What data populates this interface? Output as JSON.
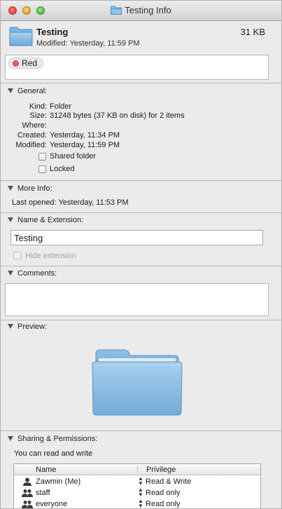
{
  "window": {
    "title": "Testing Info"
  },
  "header": {
    "name": "Testing",
    "size": "31 KB",
    "modified": "Modified: Yesterday, 11:59 PM"
  },
  "tags": [
    {
      "label": "Red",
      "color": "#f05d5d"
    }
  ],
  "general": {
    "title": "General:",
    "rows": [
      {
        "key": "Kind:",
        "value": "Folder"
      },
      {
        "key": "Size:",
        "value": "31248 bytes (37 KB on disk) for 2 items"
      },
      {
        "key": "Where:",
        "value": ""
      },
      {
        "key": "Created:",
        "value": "Yesterday, 11:34 PM"
      },
      {
        "key": "Modified:",
        "value": "Yesterday, 11:59 PM"
      }
    ],
    "shared_folder_label": "Shared folder",
    "locked_label": "Locked"
  },
  "more_info": {
    "title": "More Info:",
    "last_opened": "Last opened: Yesterday, 11:53 PM"
  },
  "name_extension": {
    "title": "Name & Extension:",
    "value": "Testing",
    "hide_extension_label": "Hide extension"
  },
  "comments": {
    "title": "Comments:",
    "value": ""
  },
  "preview": {
    "title": "Preview:"
  },
  "sharing": {
    "title": "Sharing & Permissions:",
    "status": "You can read and write",
    "columns": {
      "name": "Name",
      "privilege": "Privilege"
    },
    "rows": [
      {
        "name": "Zawmin (Me)",
        "privilege": "Read & Write",
        "icon": "user-icon"
      },
      {
        "name": "staff",
        "privilege": "Read only",
        "icon": "group-icon"
      },
      {
        "name": "everyone",
        "privilege": "Read only",
        "icon": "group-icon"
      }
    ]
  }
}
